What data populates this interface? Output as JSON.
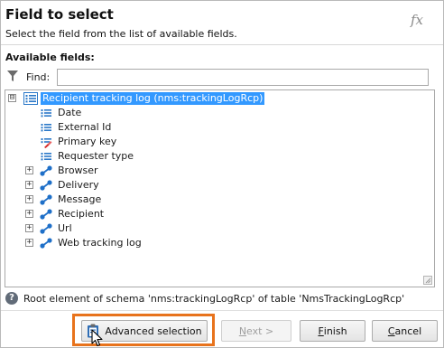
{
  "header": {
    "title": "Field to select",
    "subtitle": "Select the field from the list of available fields.",
    "fx_label": "fx"
  },
  "filter": {
    "section_label": "Available fields:",
    "find_label": "Find:",
    "find_value": ""
  },
  "tree": {
    "root": {
      "label": "Recipient tracking log (nms:trackingLogRcp)",
      "expander": "⊟",
      "icon": "list-icon",
      "selected": true
    },
    "fields": [
      {
        "label": "Date",
        "icon": "field-list-icon"
      },
      {
        "label": "External Id",
        "icon": "field-list-icon"
      },
      {
        "label": "Primary key",
        "icon": "primary-key-icon"
      },
      {
        "label": "Requester type",
        "icon": "field-list-icon"
      }
    ],
    "links": [
      {
        "label": "Browser",
        "icon": "link-icon",
        "expander": "+"
      },
      {
        "label": "Delivery",
        "icon": "link-icon",
        "expander": "+"
      },
      {
        "label": "Message",
        "icon": "link-icon",
        "expander": "+"
      },
      {
        "label": "Recipient",
        "icon": "link-icon",
        "expander": "+"
      },
      {
        "label": "Url",
        "icon": "link-icon",
        "expander": "+"
      },
      {
        "label": "Web tracking log",
        "icon": "link-icon",
        "expander": "+"
      }
    ]
  },
  "status": {
    "icon": "?",
    "text": "Root element of schema 'nms:trackingLogRcp' of table 'NmsTrackingLogRcp'"
  },
  "buttons": {
    "advanced_selection": "Advanced selection",
    "next_prefix": "N",
    "next_suffix": "ext >",
    "finish_prefix": "F",
    "finish_suffix": "inish",
    "cancel_prefix": "C",
    "cancel_suffix": "ancel"
  },
  "colors": {
    "selection": "#3399ff",
    "highlight_frame": "#e8731c",
    "icon_blue": "#1e6fc8"
  }
}
